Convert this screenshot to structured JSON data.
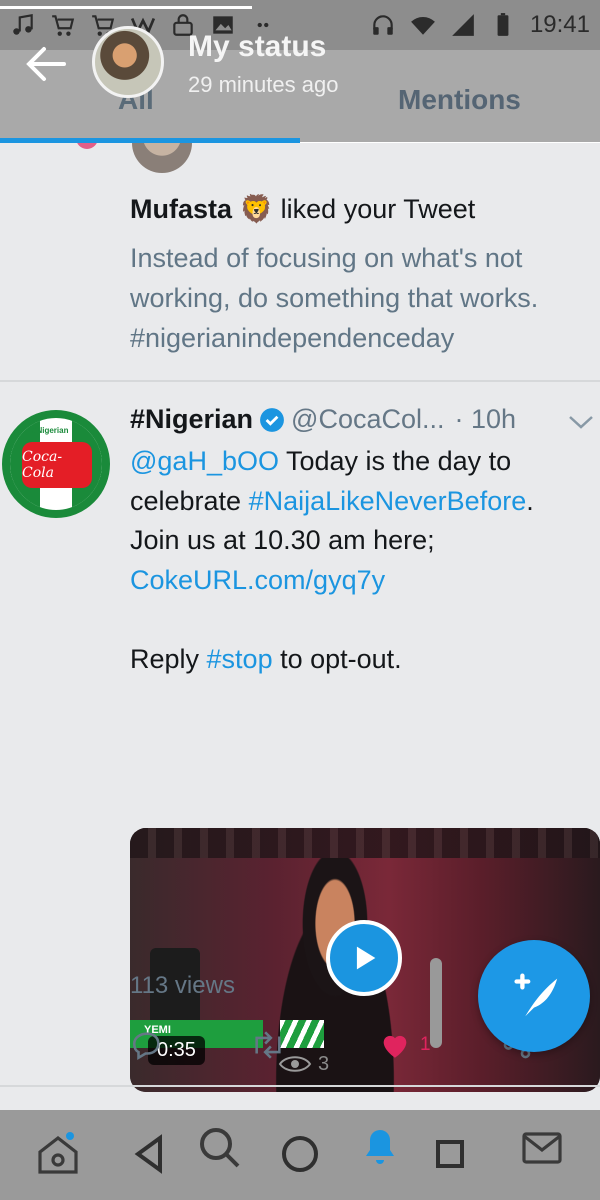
{
  "status_bar": {
    "time": "19:41",
    "icons": [
      "music-icon",
      "cart-icon",
      "cart-icon",
      "w-icon",
      "lock-icon",
      "image-icon",
      "dots-icon",
      "headset-icon",
      "wifi-icon",
      "signal-icon",
      "battery-icon"
    ]
  },
  "status_viewer": {
    "title": "My status",
    "time_ago": "29 minutes ago",
    "progress": 0.42
  },
  "tabs": {
    "all": "All",
    "mentions": "Mentions"
  },
  "notification": {
    "user": "Mufasta",
    "emoji": "🦁",
    "action": "liked your Tweet",
    "tweet_text": "Instead of focusing on what's not working, do something that works. #nigerianindependenceday"
  },
  "tweet": {
    "display_name": "#Nigerian",
    "handle": "@CocaCol...",
    "time": "· 10h",
    "avatar_tag": "#Nigerian",
    "avatar_logo": "Coca-Cola",
    "mention": "@gaH_bOO",
    "body_1": " Today is the day to celebrate ",
    "hashtag_1": "#NaijaLikeNeverBefore",
    "body_2": ". Join us at 10.30 am here; ",
    "link": "CokeURL.com/gyq7y",
    "reply_prefix": "Reply ",
    "hashtag_2": "#stop",
    "reply_suffix": " to opt-out.",
    "video": {
      "duration": "0:35",
      "caption_tag": "YEMI"
    },
    "views": "113 views",
    "likes": "1",
    "viewer_count": "3"
  },
  "colors": {
    "accent": "#1b95e0",
    "like": "#e0245e",
    "coke_red": "#e41e26",
    "nigeria_green": "#1a8a3a"
  },
  "nav": [
    "home-icon",
    "back-icon",
    "search-icon",
    "home-button-icon",
    "notifications-icon",
    "recents-icon",
    "messages-icon"
  ]
}
